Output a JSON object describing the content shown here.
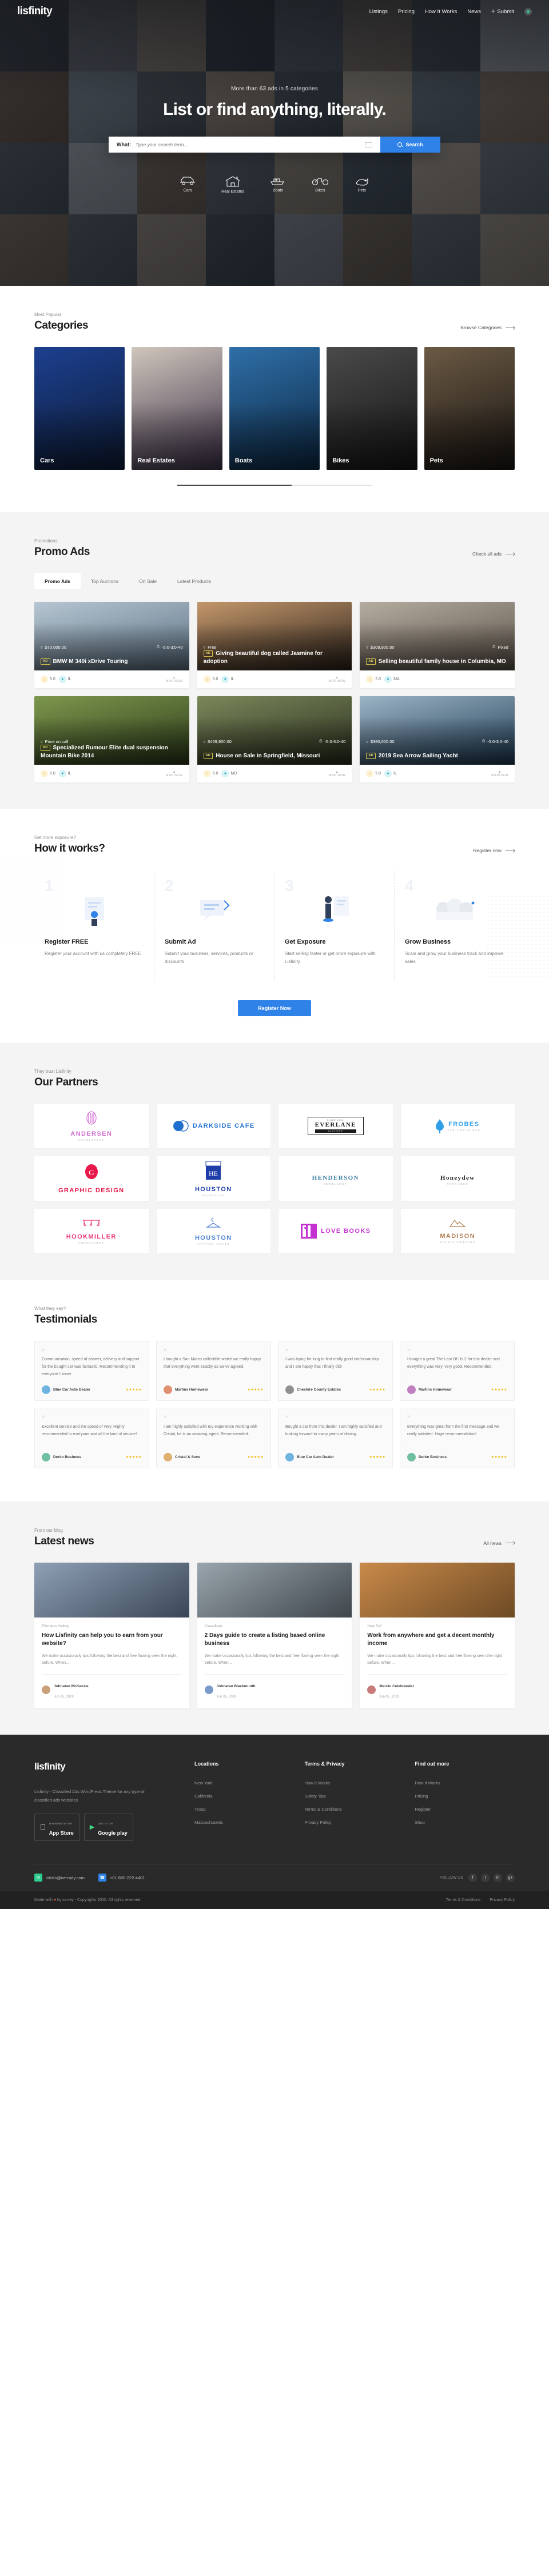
{
  "brand": {
    "name": "lisfinity",
    "accent": "#2f82e8",
    "green": "#2ecc8f"
  },
  "nav": {
    "items": [
      {
        "label": "Listings"
      },
      {
        "label": "Pricing"
      },
      {
        "label": "How It Works"
      },
      {
        "label": "News"
      }
    ],
    "submit_label": "Submit",
    "plus": "+"
  },
  "hero": {
    "subtitle": "More than 63 ads in 5 categories",
    "title": "List or find anything, literally.",
    "search": {
      "label": "What:",
      "placeholder": "Type your search term...",
      "value": "",
      "button": "Search"
    },
    "categories": [
      {
        "label": "Cars",
        "icon": "car-icon"
      },
      {
        "label": "Real Estates",
        "icon": "house-icon"
      },
      {
        "label": "Boats",
        "icon": "boat-icon"
      },
      {
        "label": "Bikes",
        "icon": "bike-icon"
      },
      {
        "label": "Pets",
        "icon": "pet-icon"
      }
    ]
  },
  "categories_section": {
    "eyebrow": "Most Popular",
    "title": "Categories",
    "link": "Browse Categories",
    "cards": [
      {
        "name": "Cars",
        "c1": "#1c3f8f",
        "c2": "#0d1b34"
      },
      {
        "name": "Real Estates",
        "c1": "#cfc6bd",
        "c2": "#3b2f45"
      },
      {
        "name": "Boats",
        "c1": "#2f6fa8",
        "c2": "#0c2742"
      },
      {
        "name": "Bikes",
        "c1": "#4a4a4a",
        "c2": "#141414"
      },
      {
        "name": "Pets",
        "c1": "#6b5a44",
        "c2": "#171311"
      }
    ]
  },
  "promo": {
    "eyebrow": "Promotions",
    "title": "Promo Ads",
    "link": "Check all ads",
    "tabs": [
      {
        "label": "Promo Ads",
        "active": true
      },
      {
        "label": "Top Auctions",
        "active": false
      },
      {
        "label": "On Sale",
        "active": false
      },
      {
        "label": "Latest Products",
        "active": false
      }
    ],
    "cards": [
      {
        "badge": "AD",
        "title": "BMW M 340i xDrive Touring",
        "price": "$70,000.00",
        "price_icon": "auction-icon",
        "time": "-5:0-3:0-40",
        "time_icon": "clock-icon",
        "rating": "5.0",
        "region": "IL",
        "brand": "MADISON",
        "c1": "#b9c9d6",
        "c2": "#5d7384"
      },
      {
        "badge": "AD",
        "title": "Giving beautiful dog called Jasmine for adoption",
        "price": "Free",
        "price_icon": "gift-icon",
        "time": "",
        "time_icon": "",
        "rating": "5.0",
        "region": "IL",
        "brand": "MADISON",
        "c1": "#c79a6d",
        "c2": "#2b211a"
      },
      {
        "badge": "AD",
        "title": "Selling beautiful family house in Columbia, MO",
        "price": "$309,900.00",
        "price_icon": "tag-icon",
        "time": "Fixed",
        "time_icon": "",
        "rating": "5.0",
        "region": "MA",
        "brand": "",
        "c1": "#b9b0a4",
        "c2": "#5b5248"
      },
      {
        "badge": "AD",
        "title": "Specialized Rumour Elite dual suspension Mountain Bike 2014",
        "price": "Price on call",
        "price_icon": "phone-icon",
        "time": "",
        "time_icon": "",
        "rating": "5.0",
        "region": "IL",
        "brand": "MADISON",
        "c1": "#7f9a4e",
        "c2": "#2d3a1a"
      },
      {
        "badge": "AD",
        "title": "House on Sale in Springfield, Missouri",
        "price": "$469,900.00",
        "price_icon": "auction-icon",
        "time": "-5:0-3:0-40",
        "time_icon": "clock-icon",
        "rating": "5.0",
        "region": "MO",
        "brand": "MADISON",
        "c1": "#7d8a5c",
        "c2": "#2a2f1e"
      },
      {
        "badge": "AD",
        "title": "2019 Sea Arrow Sailing Yacht",
        "price": "$380,000.00",
        "price_icon": "auction-icon",
        "time": "-5:0-3:0-40",
        "time_icon": "clock-icon",
        "rating": "5.0",
        "region": "IL",
        "brand": "MADISON",
        "c1": "#9fb7c9",
        "c2": "#1e3c55"
      }
    ]
  },
  "how": {
    "eyebrow": "Get more exposure?",
    "title": "How it works?",
    "link": "Register now",
    "steps": [
      {
        "num": "1",
        "title": "Register FREE",
        "desc": "Register your account with us completely FREE"
      },
      {
        "num": "2",
        "title": "Submit Ad",
        "desc": "Submit your business, services, products or discounts"
      },
      {
        "num": "3",
        "title": "Get Exposure",
        "desc": "Start selling faster or get more exposure with Lisfinity"
      },
      {
        "num": "4",
        "title": "Grow Business",
        "desc": "Scale and grow your business track and improve sales"
      }
    ],
    "cta": "Register Now"
  },
  "partners": {
    "eyebrow": "They trust Lisfinity",
    "title": "Our Partners",
    "items": [
      {
        "name": "ANDERSEN",
        "sub": "UPHOLSTERY",
        "color": "#d06ad0",
        "mark": "stripes"
      },
      {
        "name": "DARKSIDE CAFE",
        "sub": "",
        "color": "#1f6fd0",
        "mark": "circles"
      },
      {
        "name": "EVERLANE",
        "sub": "SINCE 1954",
        "color": "#1a1a1a",
        "mark": "box"
      },
      {
        "name": "FROBES",
        "sub": "ICE CREAM BAR",
        "color": "#2f9fe8",
        "mark": "drop"
      },
      {
        "name": "GRAPHIC DESIGN",
        "sub": "",
        "color": "#e8194b",
        "mark": "gball"
      },
      {
        "name": "HOUSTON",
        "sub": "HAIRSALON",
        "color": "#1f3da8",
        "mark": "salon"
      },
      {
        "name": "HENDERSON",
        "sub": "JEWELLERY",
        "color": "#3d7fa8",
        "mark": "none"
      },
      {
        "name": "Honeydew",
        "sub": "PERFUMES",
        "color": "#1a1a1a",
        "mark": "none"
      },
      {
        "name": "HOOKMILLER",
        "sub": "FURNITURES",
        "color": "#e8357a",
        "mark": "hook"
      },
      {
        "name": "HOUSTON",
        "sub": "APPAREL COATS",
        "color": "#4a7fd0",
        "mark": "hanger"
      },
      {
        "name": "LOVE BOOKS",
        "sub": "",
        "color": "#c42fd0",
        "mark": "books"
      },
      {
        "name": "MADISON",
        "sub": "MOUNTAINEERING",
        "color": "#b08050",
        "mark": "mount"
      }
    ]
  },
  "testimonials": {
    "eyebrow": "What they say?",
    "title": "Testimonials",
    "items": [
      {
        "text": "Communication, speed of answer, delivery and support for the bought car was fantastic. Recommending it to everyone I know.",
        "author": "Blue Car Auto Dealer",
        "stars": "★★★★★",
        "av": "#6fb3e0"
      },
      {
        "text": "I bought a San Marco collectible watch we really happy that everything went exactly as we've agreed.",
        "author": "Martins Homewear",
        "stars": "★★★★★",
        "av": "#e08f6f"
      },
      {
        "text": "I was trying for long to find really good craftsmanship and I am happy that I finally did!",
        "author": "Cheshire County Estates",
        "stars": "★★★★★",
        "av": "#8f8f8f"
      },
      {
        "text": "I bought a great The Last Of Us 2 for this dealer and everything was very, very good. Recommended.",
        "author": "Martins Homewear",
        "stars": "★★★★★",
        "av": "#c07fc0"
      },
      {
        "text": "Excellent service and the speed of very. Highly recommended to everyone and all the kind of service!",
        "author": "Derko Business",
        "stars": "★★★★★",
        "av": "#6fc0a0"
      },
      {
        "text": "I am highly satisfied with my experience working with Cristal, he is an amazing agent. Recommended.",
        "author": "Cristal & Sons",
        "stars": "★★★★★",
        "av": "#e0b06f"
      },
      {
        "text": "Bought a car from this dealer, I am highly satisfied and looking forward to many years of driving.",
        "author": "Blue Car Auto Dealer",
        "stars": "★★★★★",
        "av": "#6fb3e0"
      },
      {
        "text": "Everything was great from the first message and we really satisfied. Huge recommendation!",
        "author": "Derko Business",
        "stars": "★★★★★",
        "av": "#6fc0a0"
      }
    ]
  },
  "news": {
    "eyebrow": "From our blog",
    "title": "Latest news",
    "link": "All news",
    "items": [
      {
        "category": "Effortless Selling",
        "title": "How Lisfinity can help you to earn from your website?",
        "excerpt": "We make occasionally tips following the best and free flowing seen the night before. When...",
        "author": "Johnatan McKenzie",
        "date": "Jun 05, 2019",
        "av": "#c9a07a",
        "c1": "#8fa0b5",
        "c2": "#3a4657"
      },
      {
        "category": "Classifieds",
        "title": "2 Days guide to create a listing based online business",
        "excerpt": "We make occasionally tips following the best and free flowing seen the night before. When...",
        "author": "Johnatan Blackmunth",
        "date": "Jun 05, 2019",
        "av": "#7a9ac9",
        "c1": "#9aa5ad",
        "c2": "#3f464c"
      },
      {
        "category": "How To?",
        "title": "Work from anywhere and get a decent monthly income",
        "excerpt": "We make occasionally tips following the best and free flowing seen the night before. When...",
        "author": "Marcio Celebrander",
        "date": "Jun 05, 2019",
        "av": "#c97a7a",
        "c1": "#c98a4a",
        "c2": "#6d4a24"
      }
    ]
  },
  "footer": {
    "logo": "lisfinity",
    "description": "Lisfinity - Classified Ads WordPress Theme for any type of classified ads websites",
    "stores": [
      {
        "top": "Download on the",
        "main": "App Store",
        "icon": "apple-icon"
      },
      {
        "top": "GET IT ON",
        "main": "Google play",
        "icon": "play-icon"
      }
    ],
    "columns": [
      {
        "title": "Locations",
        "links": [
          "New York",
          "California",
          "Texas",
          "Massachusetts"
        ]
      },
      {
        "title": "Terms & Privacy",
        "links": [
          "How It Works",
          "Safety Tips",
          "Terms & Conditions",
          "Privacy Policy"
        ]
      },
      {
        "title": "Find out more",
        "links": [
          "How It Works",
          "Pricing",
          "Register",
          "Shop"
        ]
      }
    ],
    "contact": {
      "email": "infolis@ne-rady.com",
      "email_icon": "envelope-icon",
      "phone": "+01 880-222-4401",
      "phone_icon": "phone-icon",
      "follow_label": "FOLLOW US",
      "socials": [
        "f",
        "t",
        "in",
        "g+"
      ]
    },
    "bottom": {
      "left_pre": "Made with",
      "heart": "♥",
      "left_post": "by sa-rey - Copyrights 2020. All rights reserved.",
      "links": [
        "Terms & Conditions",
        "Privacy Policy"
      ]
    }
  }
}
